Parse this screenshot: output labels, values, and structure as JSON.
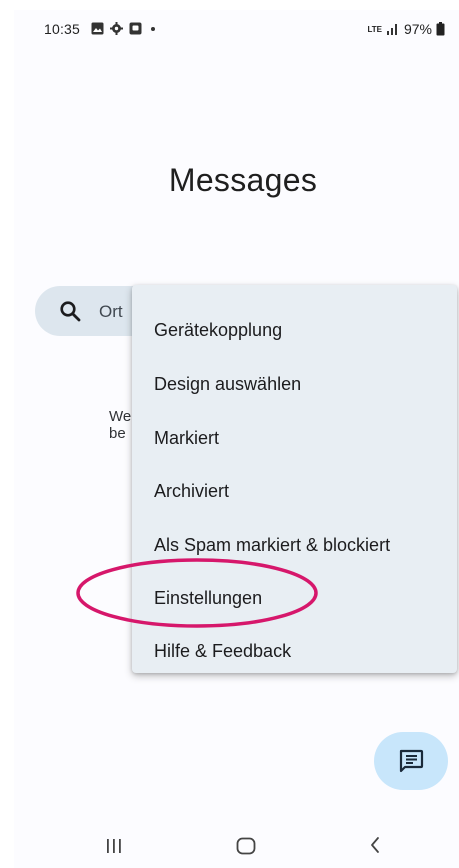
{
  "status_bar": {
    "time": "10:35",
    "notification_icons": [
      "image-icon",
      "gear-icon",
      "screen-record-icon",
      "dot-icon"
    ],
    "network": "LTE",
    "battery": "97%"
  },
  "app": {
    "title": "Messages"
  },
  "search": {
    "visible_text": "Ort"
  },
  "empty_state": {
    "line1": "We",
    "line2": "be"
  },
  "menu": {
    "items": [
      {
        "label": "Gerätekopplung"
      },
      {
        "label": "Design auswählen"
      },
      {
        "label": "Markiert"
      },
      {
        "label": "Archiviert"
      },
      {
        "label": "Als Spam markiert & blockiert"
      },
      {
        "label": "Einstellungen"
      },
      {
        "label": "Hilfe & Feedback"
      }
    ],
    "highlighted_item": "Einstellungen"
  },
  "fab": {
    "icon": "start-chat-icon"
  },
  "nav_bar": {
    "icons": [
      "recent-apps-icon",
      "home-icon",
      "back-icon"
    ]
  },
  "colors": {
    "search_bg": "#dde6ee",
    "menu_bg": "#e8eef3",
    "fab_bg": "#c8e6fb",
    "highlight_ring": "#d6176b"
  }
}
